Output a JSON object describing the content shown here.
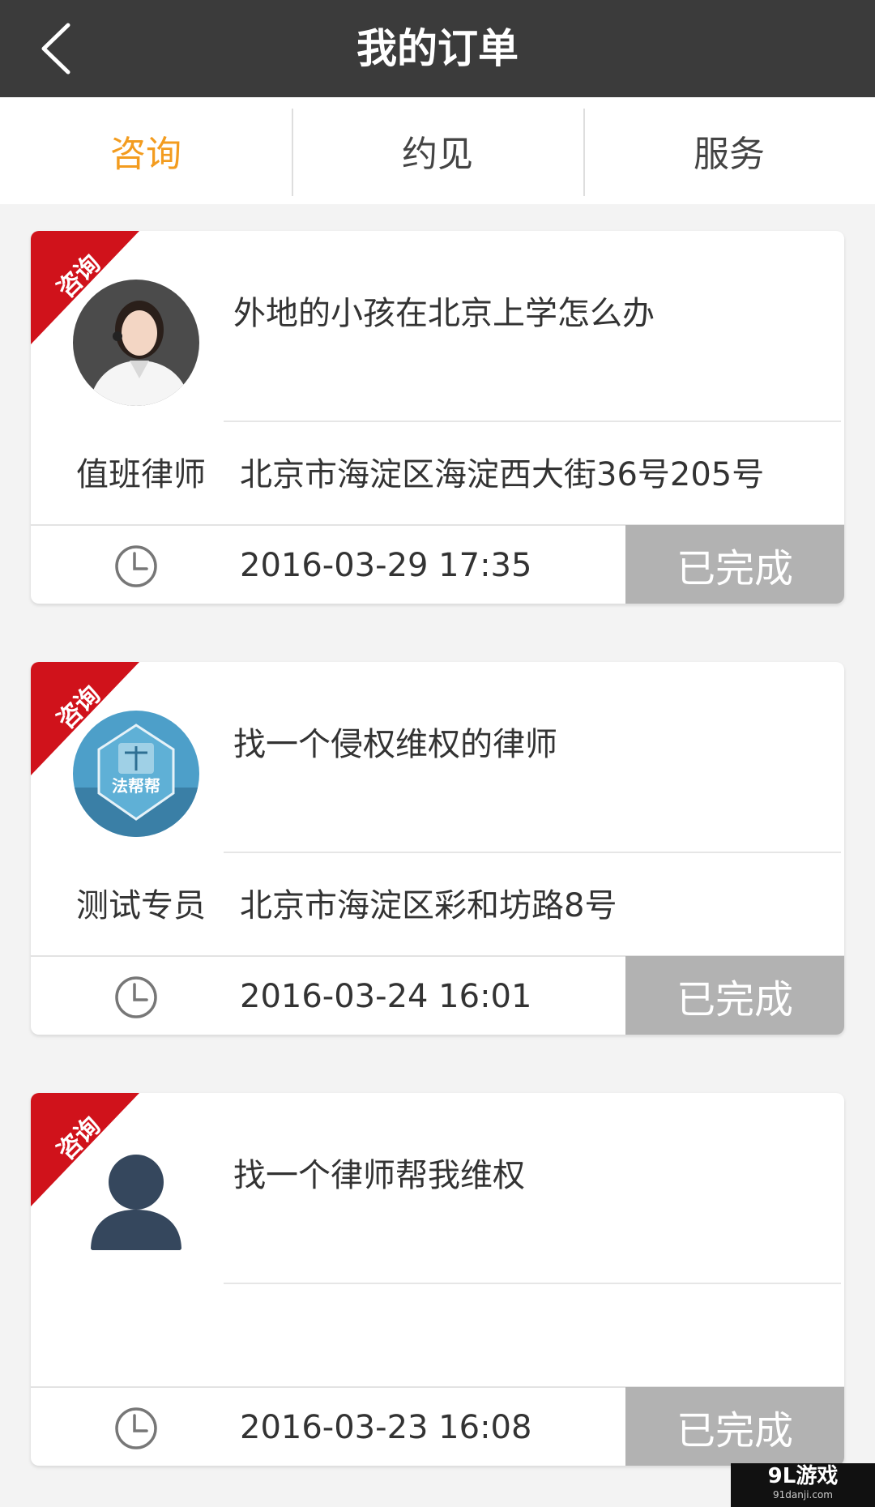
{
  "header": {
    "title": "我的订单",
    "back_icon": "chevron-left-icon"
  },
  "tabs": [
    {
      "label": "咨询",
      "active": true
    },
    {
      "label": "约见",
      "active": false
    },
    {
      "label": "服务",
      "active": false
    }
  ],
  "colors": {
    "accent": "#f39c1f",
    "ribbon": "#d0121b",
    "status_bg": "#b2b2b2",
    "topbar": "#3b3b3b"
  },
  "orders": [
    {
      "ribbon": "咨询",
      "avatar": "lawyer-photo-female",
      "question": "外地的小孩在北京上学怎么办",
      "lawyer_name": "值班律师",
      "address": "北京市海淀区海淀西大街36号205号",
      "time": "2016-03-29 17:35",
      "status": "已完成"
    },
    {
      "ribbon": "咨询",
      "avatar": "fabangbang-logo",
      "avatar_text": "法帮帮",
      "question": "找一个侵权维权的律师",
      "lawyer_name": "测试专员",
      "address": "北京市海淀区彩和坊路8号",
      "time": "2016-03-24 16:01",
      "status": "已完成"
    },
    {
      "ribbon": "咨询",
      "avatar": "default-user-silhouette",
      "question": "找一个律师帮我维权",
      "lawyer_name": "",
      "address": "",
      "time": "2016-03-23 16:08",
      "status": "已完成"
    }
  ],
  "watermark": {
    "main": "9L游戏",
    "sub": "91danji.com"
  }
}
